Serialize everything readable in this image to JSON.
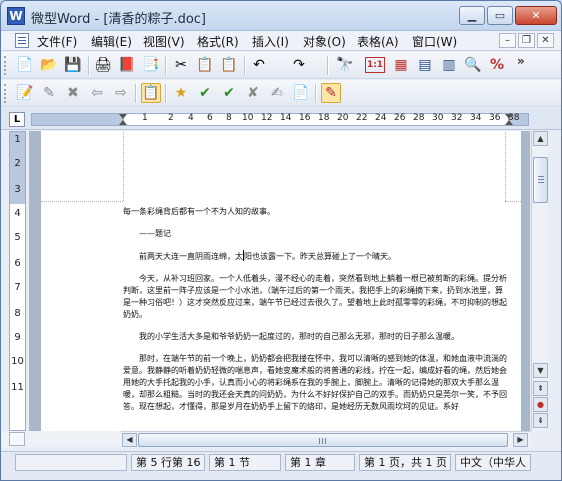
{
  "window": {
    "app_icon_letter": "W",
    "title": "微型Word - [清香的粽子.doc]",
    "minimize_glyph": "▁",
    "maximize_glyph": "▭",
    "close_glyph": "✕"
  },
  "menu": {
    "items": [
      "文件(F)",
      "编辑(E)",
      "视图(V)",
      "格式(R)",
      "插入(I)",
      "对象(O)",
      "表格(A)",
      "窗口(W)"
    ],
    "doc_minimize": "–",
    "doc_restore": "❐",
    "doc_close": "✕"
  },
  "toolbar1": {
    "buttons": [
      {
        "name": "new-document-icon",
        "glyph": "📄"
      },
      {
        "name": "open-folder-icon",
        "glyph": "📂"
      },
      {
        "name": "save-icon",
        "glyph": "💾"
      },
      {
        "name": "print-icon",
        "glyph": "🖨"
      },
      {
        "name": "pdf-export-icon",
        "glyph": "📕"
      },
      {
        "name": "print-preview-icon",
        "glyph": "📑"
      },
      {
        "name": "cut-icon",
        "glyph": "✂"
      },
      {
        "name": "copy-icon",
        "glyph": "📋"
      },
      {
        "name": "paste-icon",
        "glyph": "📋"
      },
      {
        "name": "undo-icon",
        "glyph": "↶"
      },
      {
        "name": "redo-icon",
        "glyph": "↷"
      },
      {
        "name": "find-icon",
        "glyph": "🔭"
      },
      {
        "name": "page-number-icon",
        "glyph": "1:1"
      },
      {
        "name": "insert-table-icon",
        "glyph": "▦"
      },
      {
        "name": "page-layout-icon",
        "glyph": "▤"
      },
      {
        "name": "document-map-icon",
        "glyph": "▥"
      },
      {
        "name": "zoom-icon",
        "glyph": "🔍"
      },
      {
        "name": "percent-icon",
        "glyph": "%"
      }
    ],
    "more": "»"
  },
  "toolbar2": {
    "buttons": [
      {
        "name": "edit-document-icon",
        "glyph": "📝"
      },
      {
        "name": "track-edit-icon",
        "glyph": "✎"
      },
      {
        "name": "delete-comment-icon",
        "glyph": "✖"
      },
      {
        "name": "previous-comment-icon",
        "glyph": "⇦"
      },
      {
        "name": "next-comment-icon",
        "glyph": "⇨"
      },
      {
        "name": "clipboard-icon",
        "glyph": "📋"
      },
      {
        "name": "highlight-star-icon",
        "glyph": "★"
      },
      {
        "name": "accept-change-icon",
        "glyph": "✔"
      },
      {
        "name": "accept-all-icon",
        "glyph": "✔"
      },
      {
        "name": "reject-change-icon",
        "glyph": "✘"
      },
      {
        "name": "review-pane-icon",
        "glyph": "✍"
      },
      {
        "name": "show-markup-icon",
        "glyph": "📄"
      }
    ]
  },
  "ruler": {
    "corner": "L",
    "h_numbers": [
      "1",
      "2",
      "4",
      "6",
      "8",
      "10",
      "12",
      "14",
      "16",
      "18",
      "20",
      "22",
      "24",
      "26",
      "28",
      "30",
      "32",
      "34",
      "36",
      "38",
      "40"
    ],
    "v_numbers": [
      "1",
      "2",
      "3",
      "4",
      "5",
      "6",
      "7",
      "8",
      "9",
      "10",
      "11"
    ]
  },
  "document": {
    "paragraphs": [
      {
        "text": "每一条彩绳背后都有一个不为人知的故事。",
        "indent": false
      },
      {
        "text": "——题记",
        "indent": true
      },
      {
        "text_before_cursor": "前两天大连一直阴雨连绵，太",
        "text_after_cursor": "阳也该露一下。昨天总算碰上了一个晴天。",
        "indent": true
      },
      {
        "text": "今天，从补习班回家。一个人低着头，漫不经心的走着，突然看到地上躺着一根已被剪断的彩绳。提分析判断，这里前一阵子应该是一个小水池，（端午过后的第一个雨天，我把手上的彩绳摘下来，扔到水池里，算是一种习俗吧！）这才突然反应过来，端午节已经过去很久了。望着地上此时孤零零的彩绳，不可抑制的想起奶奶。",
        "indent": true
      },
      {
        "text": "我的小学生活大多是和爷爷奶奶一起度过的，那时的自己那么无邪，那时的日子那么温暖。",
        "indent": true
      },
      {
        "text": "那时，在端午节的前一个晚上，奶奶都会把我搂在怀中，我可以清晰的感到她的体温，和她血液中流淌的爱意。我静静的听着奶奶轻微的喘息声，看她变魔术般的将普通的彩线，拧在一起，编成好看的绳，然后她会用她的大手托起我的小手，认真而小心的将彩绳系在我的手腕上，脚腕上。清晰的记得她的那双大手那么温暖，却那么粗糙。当时的我还会天真的问奶奶，为什么不好好保护自己的双手。而奶奶只是莞尔一笑，不予回答。现在想起，才懂得，那是岁月在奶奶手上留下的烙印，是她经历无数风雨坎坷的见证。系好",
        "indent": true
      }
    ]
  },
  "scrollbars": {
    "up": "▲",
    "down": "▼",
    "left": "◀",
    "right": "▶",
    "prev_page": "⇞",
    "select_browse": "●",
    "next_page": "⇟"
  },
  "status": {
    "line_col": "第 5 行第 16",
    "section": "第 1 节",
    "chapter": "第 1 章",
    "page": "第 1 页，共 1 页",
    "language": "中文（中华人"
  }
}
